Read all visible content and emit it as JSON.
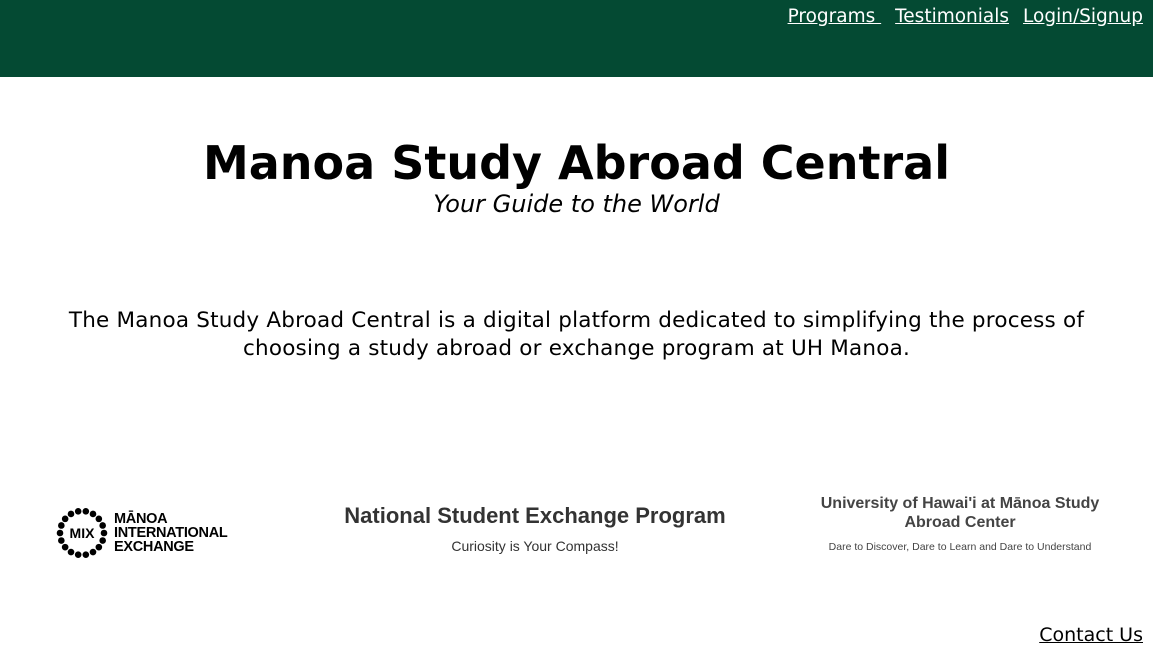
{
  "header": {
    "nav": [
      {
        "label": "Programs "
      },
      {
        "label": "Testimonials"
      },
      {
        "label": "Login/Signup"
      }
    ]
  },
  "hero": {
    "title": "Manoa Study Abroad Central",
    "subtitle": "Your Guide to the World"
  },
  "description": "The Manoa Study Abroad Central is a digital platform dedicated to simplifying the process of choosing a study abroad or exchange program at UH Manoa.",
  "partners": {
    "mix": {
      "badge": "MIX",
      "line1": "MĀNOA",
      "line2": "INTERNATIONAL",
      "line3": "EXCHANGE"
    },
    "nse": {
      "title": "National Student Exchange Program",
      "tagline": "Curiosity is Your Compass!"
    },
    "uh": {
      "title": "University of Hawai'i at Mānoa Study Abroad Center",
      "tagline": "Dare to Discover, Dare to Learn and Dare to Understand"
    }
  },
  "footer": {
    "contact_label": "Contact Us"
  },
  "colors": {
    "header_bg": "#044a33",
    "text": "#000000"
  }
}
